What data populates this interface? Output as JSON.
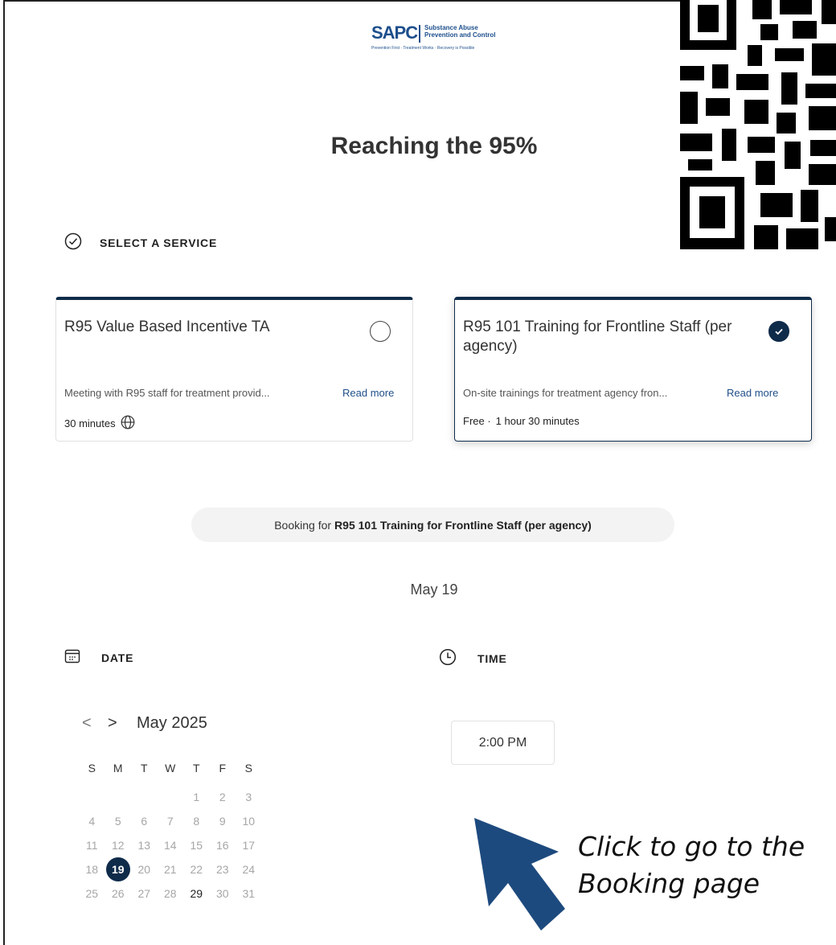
{
  "logo": {
    "brand": "SAPC",
    "org_line1": "Substance Abuse",
    "org_line2": "Prevention and Control",
    "tagline": "Prevention First · Treatment Works · Recovery is Possible"
  },
  "page_title": "Reaching the 95%",
  "service_section": {
    "label": "SELECT A SERVICE",
    "icon": "check-circle-icon"
  },
  "services": [
    {
      "title": "R95 Value Based Incentive TA",
      "description": "Meeting with R95 staff for treatment provid...",
      "read_more": "Read more",
      "meta": "30 minutes",
      "meta_icon": "globe-icon",
      "selected": false
    },
    {
      "title": "R95 101 Training for Frontline Staff (per agency)",
      "description": "On-site trainings for treatment agency fron...",
      "read_more": "Read more",
      "meta_price": "Free ·",
      "meta": "1 hour 30 minutes",
      "selected": true
    }
  ],
  "booking": {
    "prefix": "Booking for",
    "service": "R95 101 Training for Frontline Staff (per agency)"
  },
  "selected_date_label": "May 19",
  "date_section": {
    "label": "DATE",
    "icon": "calendar-icon"
  },
  "time_section": {
    "label": "TIME",
    "icon": "clock-icon"
  },
  "calendar": {
    "month": "May 2025",
    "prev": "<",
    "next": ">",
    "weekdays": [
      "S",
      "M",
      "T",
      "W",
      "T",
      "F",
      "S"
    ],
    "weeks": [
      [
        "",
        "",
        "",
        "",
        "1",
        "2",
        "3"
      ],
      [
        "4",
        "5",
        "6",
        "7",
        "8",
        "9",
        "10"
      ],
      [
        "11",
        "12",
        "13",
        "14",
        "15",
        "16",
        "17"
      ],
      [
        "18",
        "19",
        "20",
        "21",
        "22",
        "23",
        "24"
      ],
      [
        "25",
        "26",
        "27",
        "28",
        "29",
        "30",
        "31"
      ]
    ],
    "selected_day": "19",
    "available_days": [
      "19",
      "29"
    ]
  },
  "time_slots": [
    "2:00 PM"
  ],
  "callout": {
    "line1": "Click to go to the",
    "line2": "Booking page"
  },
  "colors": {
    "accent": "#0f2b4a",
    "arrow": "#1d4a7e",
    "link": "#1f4f8a"
  }
}
